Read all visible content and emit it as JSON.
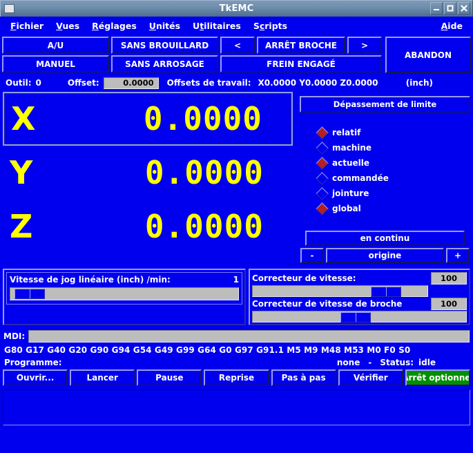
{
  "window": {
    "title": "TkEMC",
    "icon": "window-menu-icon",
    "buttons": [
      {
        "name": "minimize",
        "glyph": "minimize-icon"
      },
      {
        "name": "maximize",
        "glyph": "maximize-icon"
      },
      {
        "name": "close",
        "glyph": "close-icon"
      }
    ]
  },
  "menubar": {
    "items": [
      {
        "label": "Fichier",
        "mnemonic": "F"
      },
      {
        "label": "Vues",
        "mnemonic": "V"
      },
      {
        "label": "Réglages",
        "mnemonic": "R"
      },
      {
        "label": "Unités",
        "mnemonic": "U"
      },
      {
        "label": "Utilitaires",
        "mnemonic": "t"
      },
      {
        "label": "Scripts",
        "mnemonic": "c"
      }
    ],
    "help": {
      "label": "Aide",
      "mnemonic": "A"
    }
  },
  "modes": {
    "estop": "A/U",
    "mode": "MANUEL",
    "mist": "SANS BROUILLARD",
    "flood": "SANS ARROSAGE",
    "spindle_prev": "<",
    "spindle": "ARRÊT BROCHE",
    "spindle_next": ">",
    "brake": "FREIN ENGAGÉ",
    "abort": "ABANDON"
  },
  "toolbar": {
    "tool_label": "Outil:",
    "tool_value": "0",
    "offset_label": "Offset:",
    "offset_value": "0.0000",
    "work_offsets_label": "Offsets de travail:",
    "work_offsets_value": "X0.0000 Y0.0000 Z0.0000",
    "units": "(inch)"
  },
  "dro": {
    "axes": [
      {
        "name": "X",
        "value": "0.0000",
        "selected": true
      },
      {
        "name": "Y",
        "value": "0.0000",
        "selected": false
      },
      {
        "name": "Z",
        "value": "0.0000",
        "selected": false
      }
    ]
  },
  "side": {
    "limit_button": "Dépassement de limite",
    "radios": [
      {
        "label": "relatif",
        "selected": true
      },
      {
        "label": "machine",
        "selected": false
      },
      {
        "label": "actuelle",
        "selected": true
      },
      {
        "label": "commandée",
        "selected": false
      },
      {
        "label": "jointure",
        "selected": false
      },
      {
        "label": "global",
        "selected": true
      }
    ],
    "jog_mode": "en continu",
    "jog_minus": "-",
    "jog_home": "origine",
    "jog_plus": "+"
  },
  "jog_speed": {
    "label": "Vitesse de jog linéaire   (inch)  /min:",
    "value": "1",
    "thumb_percent": 2
  },
  "overrides": {
    "feed": {
      "label": "Correcteur de vitesse:",
      "value": "100",
      "thumb_percent": 82
    },
    "spindle": {
      "label": "Correcteur de vitesse de broche",
      "value": "100",
      "thumb_percent": 48
    }
  },
  "mdi": {
    "label": "MDI:",
    "value": "",
    "placeholder": ""
  },
  "gcodes": "G80 G17 G40 G20 G90 G94 G54 G49 G99 G64 G0 G97 G91.1 M5 M9 M48 M53 M0 F0 S0",
  "program": {
    "label": "Programme:",
    "file": "none",
    "separator": "-",
    "status_label": "Status:",
    "status_value": "idle"
  },
  "program_buttons": [
    {
      "label": "Ouvrir...",
      "name": "open-button",
      "green": false
    },
    {
      "label": "Lancer",
      "name": "run-button",
      "green": false
    },
    {
      "label": "Pause",
      "name": "pause-button",
      "green": false
    },
    {
      "label": "Reprise",
      "name": "resume-button",
      "green": false
    },
    {
      "label": "Pas à pas",
      "name": "step-button",
      "green": false
    },
    {
      "label": "Vérifier",
      "name": "verify-button",
      "green": false
    },
    {
      "label": "Arrêt optionnel",
      "name": "optional-stop-button",
      "green": true
    }
  ],
  "program_text": "",
  "colors": {
    "bg_blue": "#0000ee",
    "dro_yellow": "#ffff00",
    "accent_green": "#009000",
    "radio_on": "#b52020",
    "entry_gray": "#bdbdbd",
    "titlebar": "#6d8cab"
  }
}
